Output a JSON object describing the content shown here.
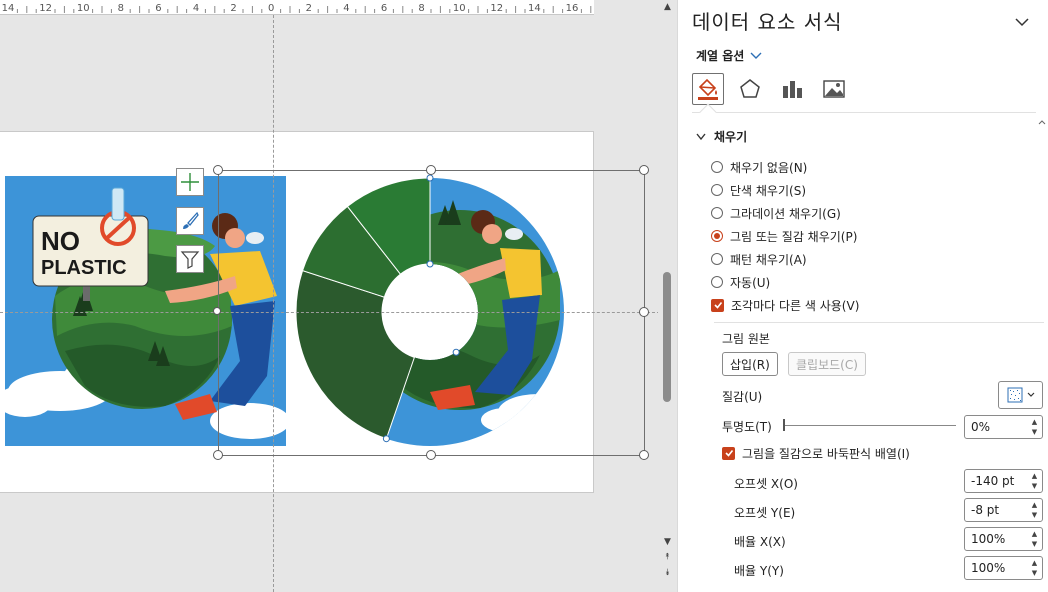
{
  "ruler": {
    "labels": [
      "14",
      "12",
      "10",
      "8",
      "6",
      "4",
      "2",
      "0",
      "2",
      "4",
      "6",
      "8",
      "10",
      "12",
      "14",
      "16"
    ]
  },
  "chart_tools": {
    "add_element": "chart-elements-icon",
    "style": "chart-styles-icon",
    "filter": "chart-filters-icon"
  },
  "illustration": {
    "sign_line1": "NO",
    "sign_line2": "PLASTIC"
  },
  "pane": {
    "title": "데이터 요소 서식",
    "series_options": "계열 옵션",
    "tabs": [
      "fill-line-icon",
      "effects-icon",
      "series-options-icon",
      "picture-icon"
    ],
    "section": "채우기",
    "fill_options": [
      {
        "label": "채우기 없음(N)",
        "selected": false
      },
      {
        "label": "단색 채우기(S)",
        "selected": false
      },
      {
        "label": "그라데이션 채우기(G)",
        "selected": false
      },
      {
        "label": "그림 또는 질감 채우기(P)",
        "selected": true
      },
      {
        "label": "패턴 채우기(A)",
        "selected": false
      },
      {
        "label": "자동(U)",
        "selected": false
      }
    ],
    "vary_colors": {
      "label": "조각마다 다른 색 사용(V)",
      "checked": true
    },
    "picture_source": "그림 원본",
    "insert_button": "삽입(R)",
    "clipboard_button": "클립보드(C)",
    "texture_label": "질감(U)",
    "transparency_label": "투명도(T)",
    "transparency_value": "0%",
    "tile_checkbox": {
      "label": "그림을 질감으로 바둑판식 배열(I)",
      "checked": true
    },
    "offset_x_label": "오프셋 X(O)",
    "offset_x_value": "-140 pt",
    "offset_y_label": "오프셋 Y(E)",
    "offset_y_value": "-8 pt",
    "scale_x_label": "배율 X(X)",
    "scale_x_value": "100%",
    "scale_y_label": "배율 Y(Y)",
    "scale_y_value": "100%"
  },
  "colors": {
    "accent": "#c8411b",
    "slice_green_light": "#2a7b34",
    "slice_green_mid": "#2c6e30",
    "slice_green_dark": "#2b5a2d",
    "sky_blue": "#3d94d8"
  }
}
